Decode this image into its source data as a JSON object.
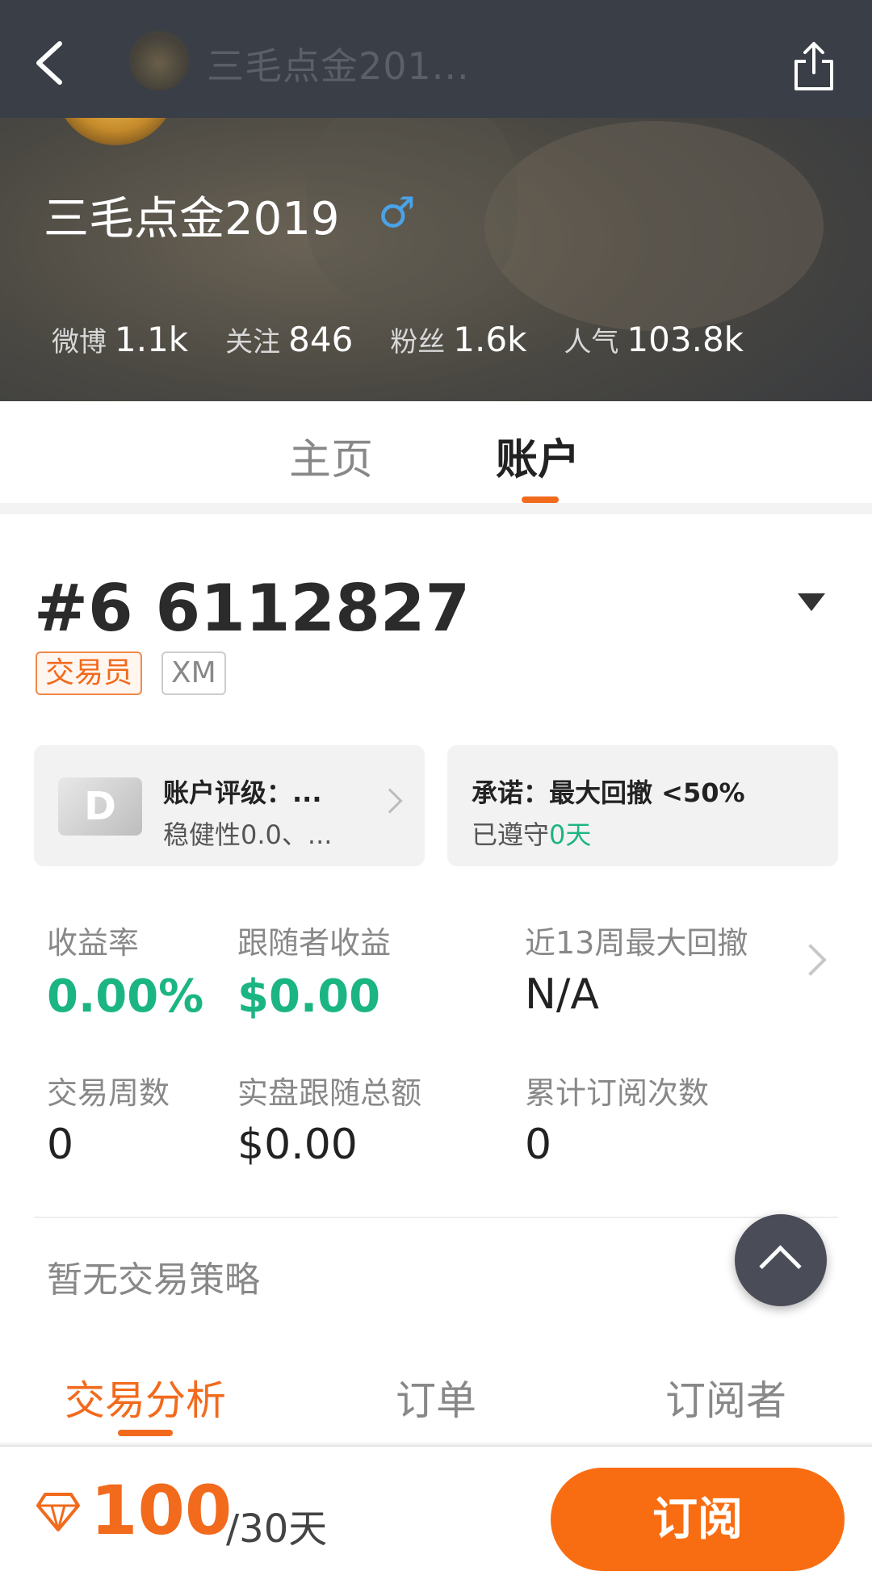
{
  "header": {
    "title": "三毛点金201...",
    "username": "三毛点金2019",
    "gender_symbol": "♂",
    "stats": [
      {
        "label": "微博",
        "value": "1.1k"
      },
      {
        "label": "关注",
        "value": "846"
      },
      {
        "label": "粉丝",
        "value": "1.6k"
      },
      {
        "label": "人气",
        "value": "103.8k"
      }
    ]
  },
  "main_tabs": [
    {
      "label": "主页",
      "active": false
    },
    {
      "label": "账户",
      "active": true
    }
  ],
  "account": {
    "id": "#6 6112827",
    "role_badge": "交易员",
    "broker_badge": "XM",
    "rating": {
      "grade": "D",
      "title": "账户评级：...",
      "subtitle": "稳健性0.0、..."
    },
    "promise": {
      "title": "承诺：最大回撤 <50%",
      "kept_prefix": "已遵守",
      "kept_value": "0天"
    },
    "metrics": [
      {
        "label": "收益率",
        "value": "0.00%"
      },
      {
        "label": "跟随者收益",
        "value": "$0.00"
      },
      {
        "label": "近13周最大回撤",
        "value": "N/A"
      },
      {
        "label": "交易周数",
        "value": "0"
      },
      {
        "label": "实盘跟随总额",
        "value": "$0.00"
      },
      {
        "label": "累计订阅次数",
        "value": "0"
      }
    ],
    "strategy": "暂无交易策略"
  },
  "sub_tabs": [
    {
      "label": "交易分析",
      "active": true
    },
    {
      "label": "订单",
      "active": false
    },
    {
      "label": "订阅者",
      "active": false
    }
  ],
  "footer": {
    "price": "100",
    "period": "/30天",
    "subscribe_label": "订阅"
  },
  "colors": {
    "accent": "#f26a1c",
    "positive": "#1bb583",
    "header_bg": "#3a3e46"
  }
}
